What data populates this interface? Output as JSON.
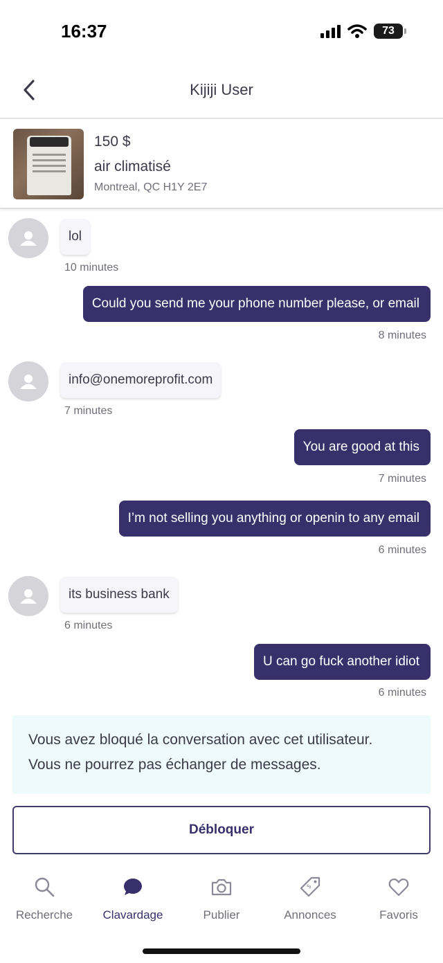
{
  "status_bar": {
    "time": "16:37",
    "battery": "73"
  },
  "header": {
    "title": "Kijiji User"
  },
  "listing": {
    "price": "150 $",
    "name": "air climatisé",
    "location": "Montreal, QC H1Y 2E7"
  },
  "messages": [
    {
      "text": "lol",
      "time": "10 minutes"
    },
    {
      "text": "Could you send me your phone number please, or email",
      "time": "8 minutes"
    },
    {
      "text": "info@onemoreprofit.com",
      "time": "7 minutes"
    },
    {
      "text": "You are good at this",
      "time": "7 minutes"
    },
    {
      "text": "I’m not selling you anything or openin to any email",
      "time": "6 minutes"
    },
    {
      "text": "its business bank",
      "time": "6 minutes"
    },
    {
      "text": "U can go fuck another idiot",
      "time": "6 minutes"
    }
  ],
  "blocked_notice": {
    "line1": "Vous avez bloqué la conversation avec cet utilisateur.",
    "line2": "Vous ne pourrez pas échanger de messages."
  },
  "unblock_label": "Débloquer",
  "tabs": [
    {
      "label": "Recherche",
      "icon": "search-icon"
    },
    {
      "label": "Clavardage",
      "icon": "chat-icon"
    },
    {
      "label": "Publier",
      "icon": "camera-icon"
    },
    {
      "label": "Annonces",
      "icon": "tag-icon"
    },
    {
      "label": "Favoris",
      "icon": "heart-icon"
    }
  ],
  "colors": {
    "accent": "#37306b",
    "notice_bg": "#eefafc",
    "incoming_bg": "#f6f5fa"
  }
}
